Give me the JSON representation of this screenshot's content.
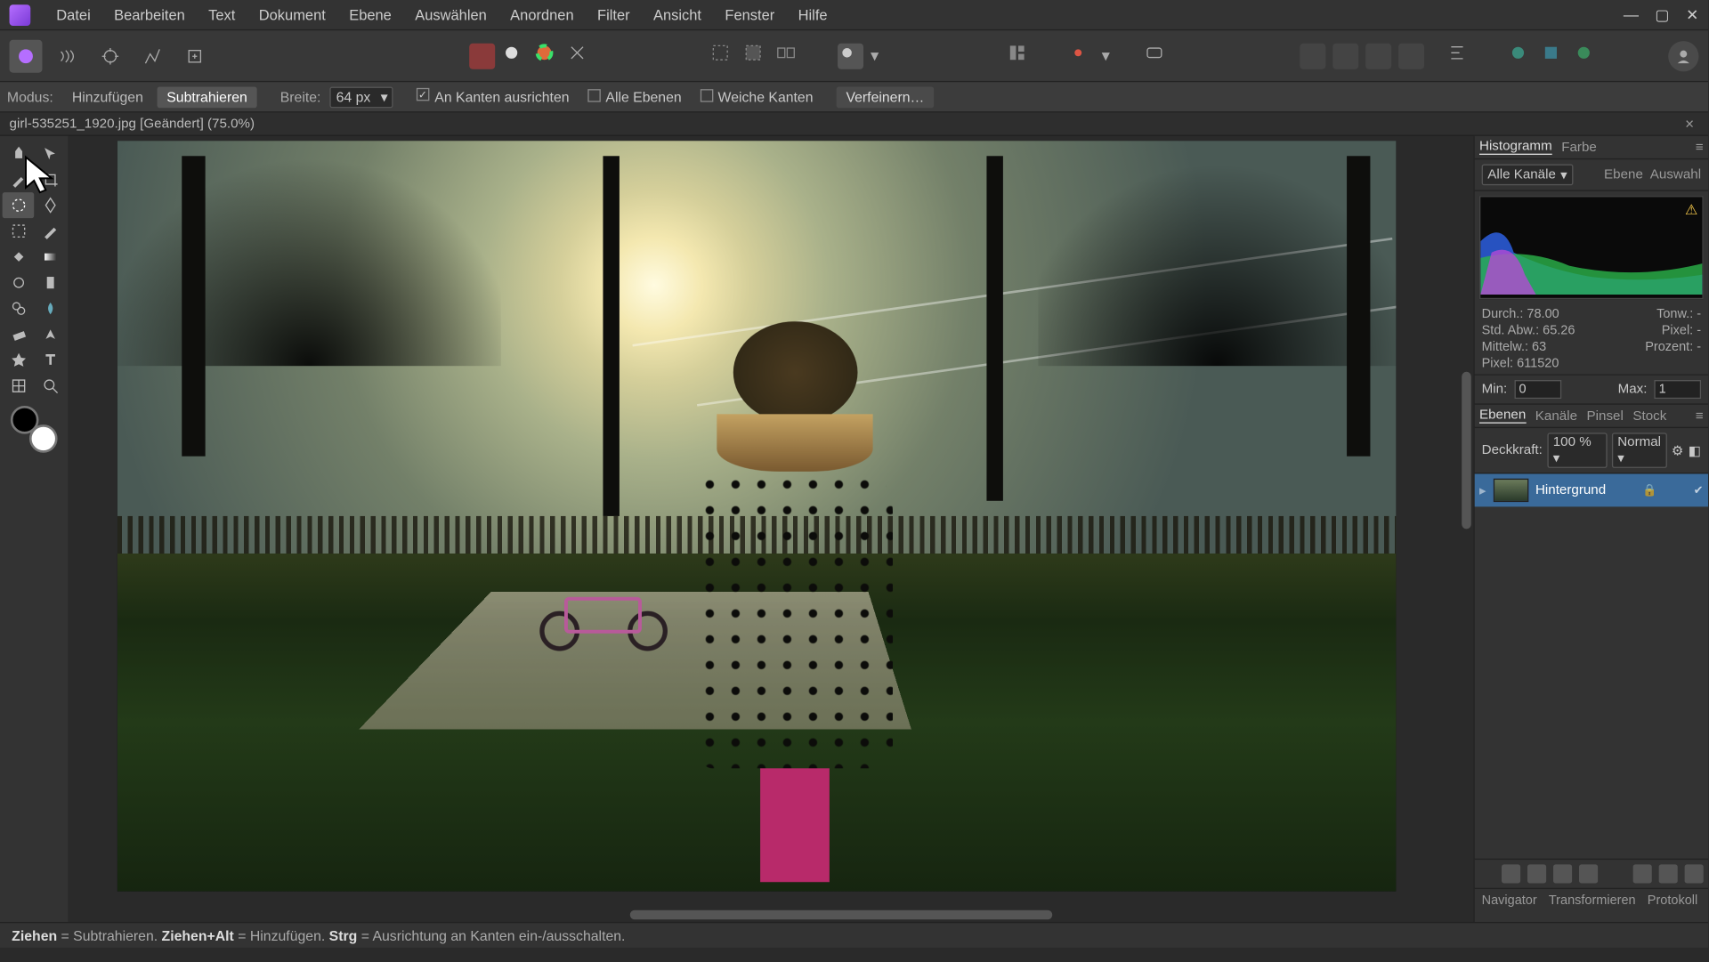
{
  "menu": [
    "Datei",
    "Bearbeiten",
    "Text",
    "Dokument",
    "Ebene",
    "Auswählen",
    "Anordnen",
    "Filter",
    "Ansicht",
    "Fenster",
    "Hilfe"
  ],
  "context": {
    "modus_label": "Modus:",
    "add": "Hinzufügen",
    "sub": "Subtrahieren",
    "width_label": "Breite:",
    "width_value": "64 px",
    "snap": "An Kanten ausrichten",
    "all_layers": "Alle Ebenen",
    "soft_edges": "Weiche Kanten",
    "refine": "Verfeinern…"
  },
  "doc_tab": "girl-535251_1920.jpg [Geändert] (75.0%)",
  "hist": {
    "tabs": [
      "Histogramm",
      "Farbe"
    ],
    "channel": "Alle Kanäle",
    "ebene": "Ebene",
    "auswahl": "Auswahl",
    "durch_label": "Durch.:",
    "durch_val": "78.00",
    "stdabw_label": "Std. Abw.:",
    "stdabw_val": "65.26",
    "mittelw_label": "Mittelw.:",
    "mittelw_val": "63",
    "pixel_label": "Pixel:",
    "pixel_val": "611520",
    "tonw_label": "Tonw.:",
    "tonw_val": "-",
    "pix2_label": "Pixel:",
    "pix2_val": "-",
    "proz_label": "Prozent:",
    "proz_val": "-",
    "min_label": "Min:",
    "min_val": "0",
    "max_label": "Max:",
    "max_val": "1"
  },
  "layers": {
    "tabs": [
      "Ebenen",
      "Kanäle",
      "Pinsel",
      "Stock"
    ],
    "opacity_label": "Deckkraft:",
    "opacity_val": "100 %",
    "blend": "Normal",
    "layer_name": "Hintergrund"
  },
  "bottom_tabs": [
    "Navigator",
    "Transformieren",
    "Protokoll"
  ],
  "status": {
    "s1": "Ziehen",
    "eq1": " = Subtrahieren. ",
    "s2": "Ziehen+Alt",
    "eq2": " = Hinzufügen. ",
    "s3": "Strg",
    "eq3": " = Ausrichtung an Kanten ein-/ausschalten."
  }
}
